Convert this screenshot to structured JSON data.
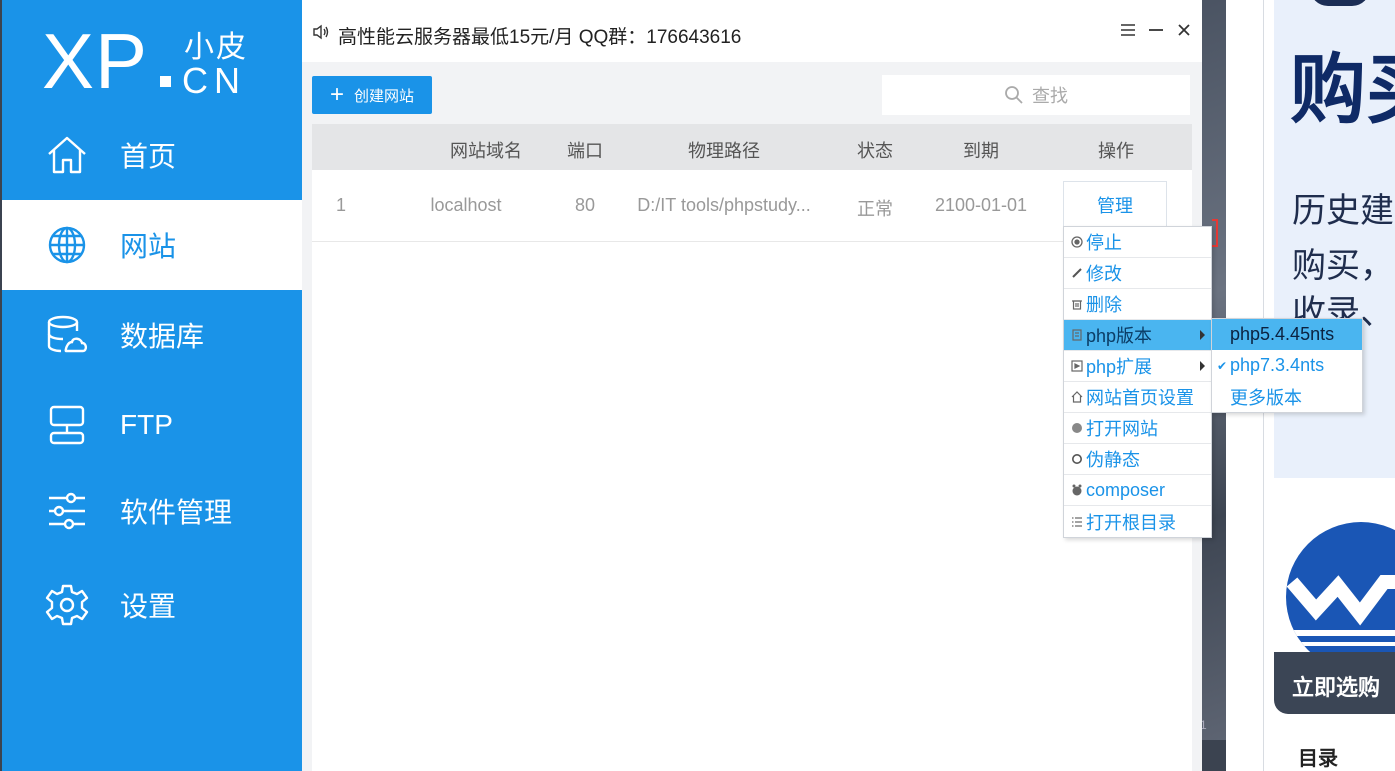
{
  "notice": "高性能云服务器最低15元/月  QQ群：176643616",
  "logo": {
    "brand": "XP",
    "cn_top": "小皮",
    "cn_bottom": "CN"
  },
  "nav": [
    {
      "label": "首页",
      "icon": "home-icon"
    },
    {
      "label": "网站",
      "icon": "globe-icon",
      "active": true
    },
    {
      "label": "数据库",
      "icon": "database-icon"
    },
    {
      "label": "FTP",
      "icon": "ftp-icon"
    },
    {
      "label": "软件管理",
      "icon": "sliders-icon"
    },
    {
      "label": "设置",
      "icon": "gear-icon"
    }
  ],
  "toolbar": {
    "create_label": "创建网站",
    "search_placeholder": "查找"
  },
  "table": {
    "headers": {
      "domain": "网站域名",
      "port": "端口",
      "path": "物理路径",
      "status": "状态",
      "expire": "到期",
      "action": "操作"
    },
    "rows": [
      {
        "index": "1",
        "domain": "localhost",
        "port": "80",
        "path": "D:/IT tools/phpstudy...",
        "status": "正常",
        "expire": "2100-01-01",
        "action": "管理"
      }
    ]
  },
  "context_menu": [
    {
      "label": "停止",
      "icon": "stop-icon"
    },
    {
      "label": "修改",
      "icon": "edit-icon"
    },
    {
      "label": "删除",
      "icon": "trash-icon"
    },
    {
      "label": "php版本",
      "icon": "php-version-icon",
      "submenu": true,
      "hover": true
    },
    {
      "label": "php扩展",
      "icon": "php-extension-icon",
      "submenu": true
    },
    {
      "label": "网站首页设置",
      "icon": "homepage-icon"
    },
    {
      "label": "打开网站",
      "icon": "open-site-icon"
    },
    {
      "label": "伪静态",
      "icon": "rewrite-icon"
    },
    {
      "label": "composer",
      "icon": "composer-icon"
    },
    {
      "label": "打开根目录",
      "icon": "folder-list-icon"
    }
  ],
  "php_versions": [
    {
      "label": "php5.4.45nts",
      "hover": true,
      "checked": false
    },
    {
      "label": "php7.3.4nts",
      "checked": true
    },
    {
      "label": "更多版本",
      "checked": false
    }
  ],
  "webpage": {
    "big_title": "购买",
    "line1": "历史建",
    "line2": "购买，",
    "line3": "收录、",
    "buy_button": "立即选购",
    "toc": "目录"
  },
  "colors": {
    "accent": "#1a93e8",
    "menu_hover": "#4ab5f0",
    "header_bg": "#e4e5e7"
  }
}
